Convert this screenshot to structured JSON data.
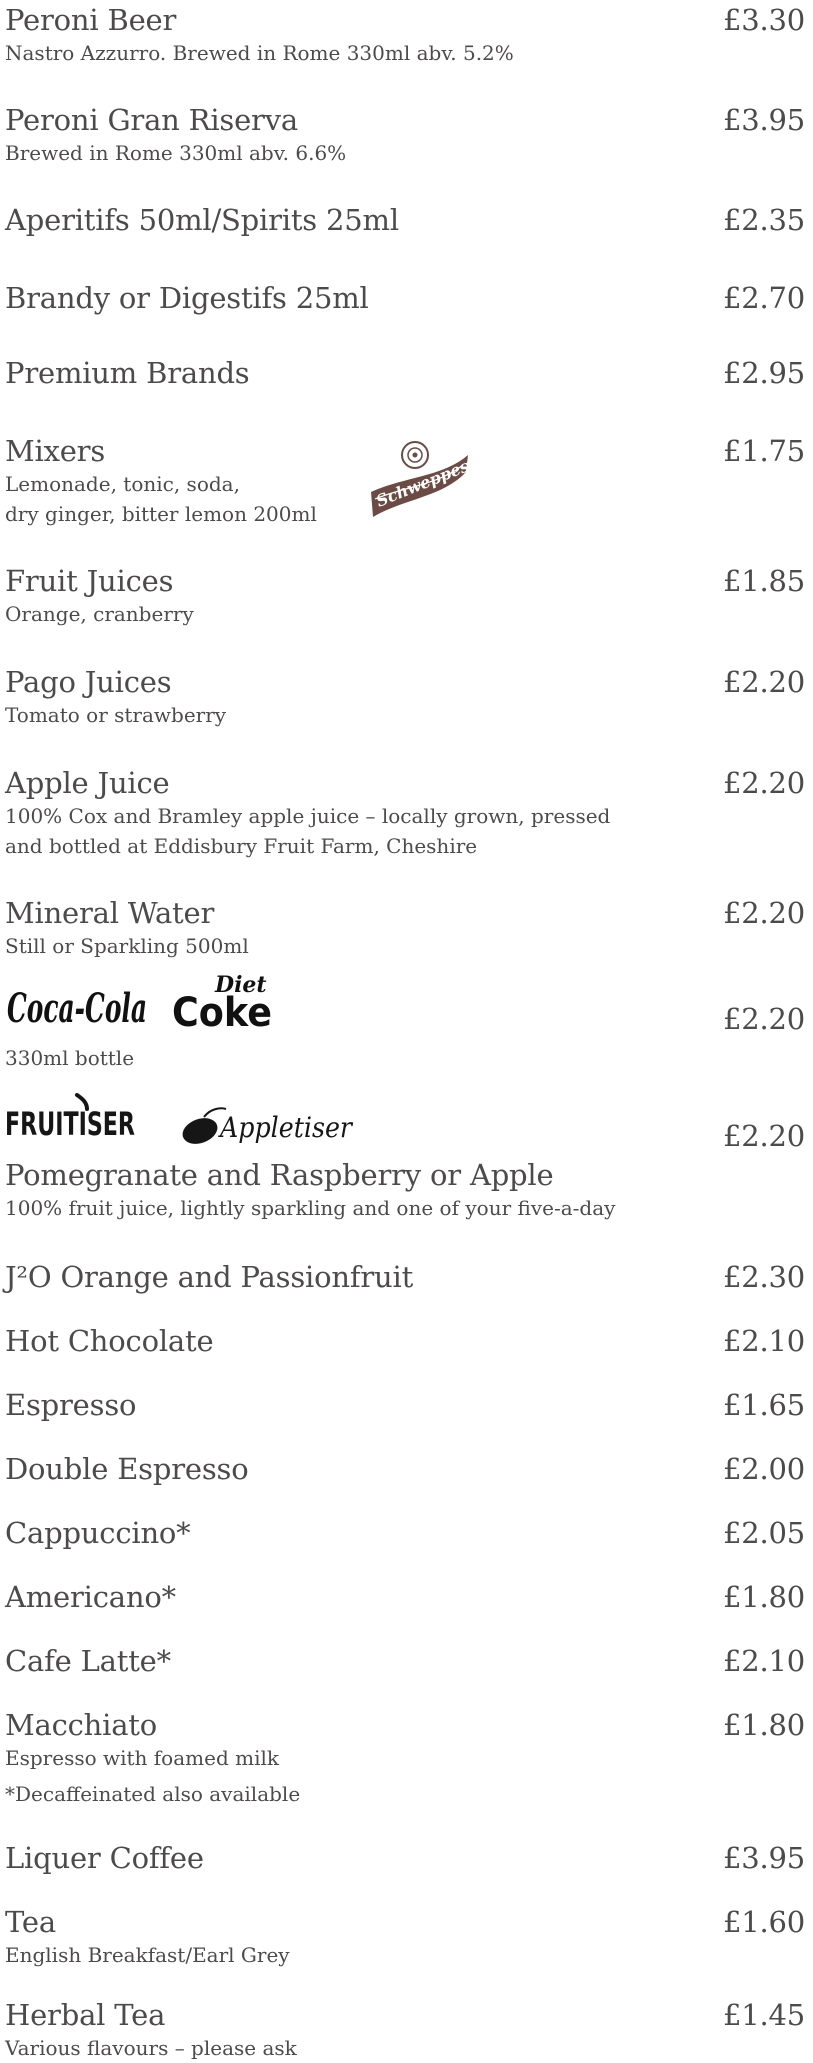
{
  "items": [
    {
      "name": "Peroni Beer",
      "price": "£3.30",
      "desc": [
        "Nastro Azzurro. Brewed in Rome 330ml abv. 5.2%"
      ]
    },
    {
      "name": "Peroni Gran Riserva",
      "price": "£3.95",
      "desc": [
        "Brewed in Rome 330ml abv. 6.6%"
      ]
    },
    {
      "name": "Aperitifs 50ml/Spirits 25ml",
      "price": "£2.35",
      "desc": []
    },
    {
      "name": "Brandy or Digestifs 25ml",
      "price": "£2.70",
      "desc": []
    },
    {
      "name": "Premium Brands",
      "price": "£2.95",
      "desc": []
    },
    {
      "name": "Mixers",
      "price": "£1.75",
      "desc": [
        "Lemonade, tonic, soda,",
        "dry ginger, bitter lemon 200ml"
      ]
    },
    {
      "name": "Fruit Juices",
      "price": "£1.85",
      "desc": [
        "Orange, cranberry"
      ]
    },
    {
      "name": "Pago Juices",
      "price": "£2.20",
      "desc": [
        "Tomato or strawberry"
      ]
    },
    {
      "name": "Apple Juice",
      "price": "£2.20",
      "desc": [
        "100% Cox and Bramley apple juice – locally grown, pressed",
        "and bottled at Eddisbury Fruit Farm, Cheshire"
      ]
    },
    {
      "name": "Mineral Water",
      "price": "£2.20",
      "desc": [
        "Still or Sparkling 500ml"
      ]
    },
    {
      "name": "",
      "price": "£2.20",
      "desc": [
        "330ml bottle"
      ]
    },
    {
      "name": "Pomegranate and Raspberry or Apple",
      "price": "£2.20",
      "desc": [
        "100% fruit juice, lightly sparkling and one of your five-a-day"
      ]
    },
    {
      "name": "J²O Orange and Passionfruit",
      "price": "£2.30",
      "desc": []
    },
    {
      "name": "Hot Chocolate",
      "price": "£2.10",
      "desc": []
    },
    {
      "name": "Espresso",
      "price": "£1.65",
      "desc": []
    },
    {
      "name": "Double Espresso",
      "price": "£2.00",
      "desc": []
    },
    {
      "name": "Cappuccino*",
      "price": "£2.05",
      "desc": []
    },
    {
      "name": "Americano*",
      "price": "£1.80",
      "desc": []
    },
    {
      "name": "Cafe Latte*",
      "price": "£2.10",
      "desc": []
    },
    {
      "name": "Macchiato",
      "price": "£1.80",
      "desc": [
        "Espresso with foamed milk",
        "*Decaffeinated also available"
      ]
    },
    {
      "name": "Liquer Coffee",
      "price": "£3.95",
      "desc": []
    },
    {
      "name": "Tea",
      "price": "£1.60",
      "desc": [
        "English Breakfast/Earl Grey"
      ]
    },
    {
      "name": "Herbal Tea",
      "price": "£1.45",
      "desc": [
        "Various flavours – please ask"
      ]
    }
  ],
  "logos": {
    "schweppes": "Schweppes",
    "coca_cola": "Coca-Cola",
    "diet": "Diet",
    "coke": "Coke",
    "fruitiser": "FRUITISER",
    "appletiser": "Appletiser"
  },
  "colors": {
    "text": "#4d4a4b",
    "schweppes": "#6b4b43"
  },
  "icons": [
    "schweppes-logo",
    "coca-cola-logo",
    "diet-coke-logo",
    "fruitiser-logo",
    "appletiser-logo"
  ]
}
